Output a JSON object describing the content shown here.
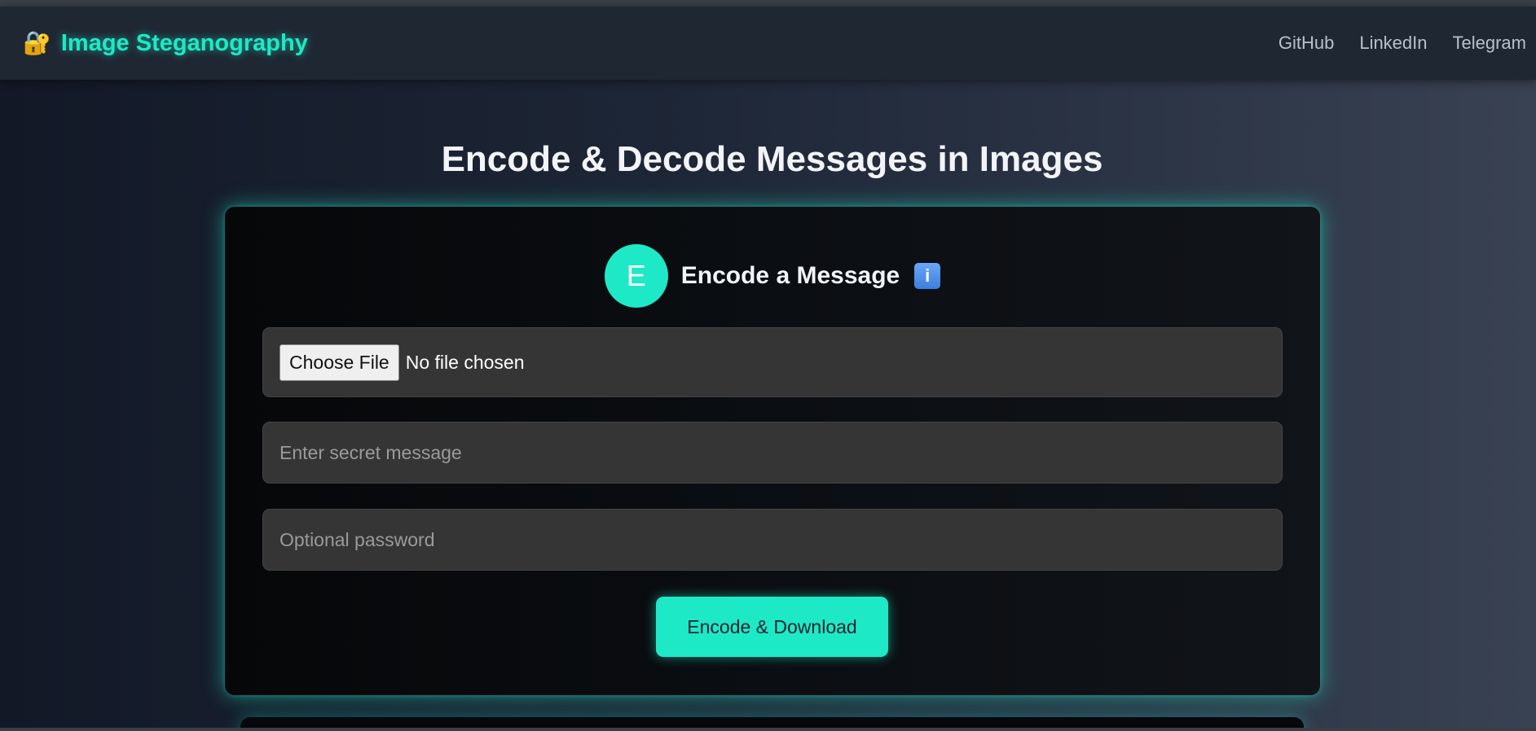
{
  "navbar": {
    "brand_icon": "lock-with-key-icon",
    "brand_icon_glyph": "🔐",
    "brand_title": "Image Steganography",
    "links": [
      {
        "label": "GitHub"
      },
      {
        "label": "LinkedIn"
      },
      {
        "label": "Telegram"
      }
    ]
  },
  "main": {
    "title": "Encode & Decode Messages in Images"
  },
  "encode_card": {
    "badge_letter": "E",
    "title": "Encode a Message",
    "info_icon": "info-icon",
    "info_glyph": "i",
    "file_input": {
      "button_label": "Choose File",
      "status": "No file chosen"
    },
    "message_input": {
      "value": "",
      "placeholder": "Enter secret message"
    },
    "password_input": {
      "value": "",
      "placeholder": "Optional password"
    },
    "submit_label": "Encode & Download"
  },
  "colors": {
    "accent": "#1de9c6",
    "navbar_bg": "#1f2733",
    "card_bg": "#0b0e12",
    "field_bg": "#353535",
    "info_icon_bg": "#3c7fe0"
  }
}
